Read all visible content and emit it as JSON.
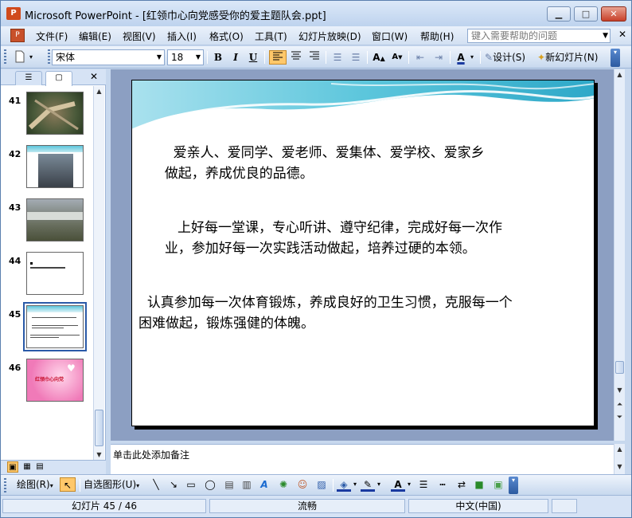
{
  "window": {
    "title": "Microsoft PowerPoint - [红领巾心向党感受你的爱主题队会.ppt]",
    "app_icon": "P",
    "minimize": "▁",
    "maximize": "□",
    "close": "✕"
  },
  "menu": {
    "items": [
      "文件(F)",
      "编辑(E)",
      "视图(V)",
      "插入(I)",
      "格式(O)",
      "工具(T)",
      "幻灯片放映(D)",
      "窗口(W)",
      "帮助(H)"
    ],
    "help_placeholder": "键入需要帮助的问题"
  },
  "toolbar": {
    "font_name": "宋体",
    "font_size": "18",
    "bold": "B",
    "italic": "I",
    "underline": "U",
    "design_label": "设计(S)",
    "new_slide_label": "新幻灯片(N)"
  },
  "panel": {
    "close": "✕",
    "slides": [
      {
        "num": "41",
        "kind": "photo-aerial"
      },
      {
        "num": "42",
        "kind": "photo-hall"
      },
      {
        "num": "43",
        "kind": "photo-station"
      },
      {
        "num": "44",
        "kind": "text-small"
      },
      {
        "num": "45",
        "kind": "text-current",
        "selected": true
      },
      {
        "num": "46",
        "kind": "pink-title",
        "text": "红领巾心向党"
      }
    ]
  },
  "slide": {
    "paragraphs": [
      "    爱亲人、爱同学、爱老师、爱集体、爱学校、爱家乡\n  做起，养成优良的品德。",
      "     上好每一堂课，专心听讲、遵守纪律，完成好每一次作\n  业，参加好每一次实践活动做起，培养过硬的本领。",
      "  认真参加每一次体育锻炼，养成良好的卫生习惯，克服每一个\n困难做起，锻炼强健的体魄。"
    ]
  },
  "notes": {
    "placeholder": "单击此处添加备注"
  },
  "drawbar": {
    "draw_label": "绘图(R)",
    "autoshape_label": "自选图形(U)"
  },
  "status": {
    "slide_info": "幻灯片 45 / 46",
    "design": "流畅",
    "language": "中文(中国)"
  },
  "colors": {
    "chrome": "#c7d8ee",
    "stage": "#8c9fc2",
    "accent_cyan": "#5cc6dc"
  }
}
